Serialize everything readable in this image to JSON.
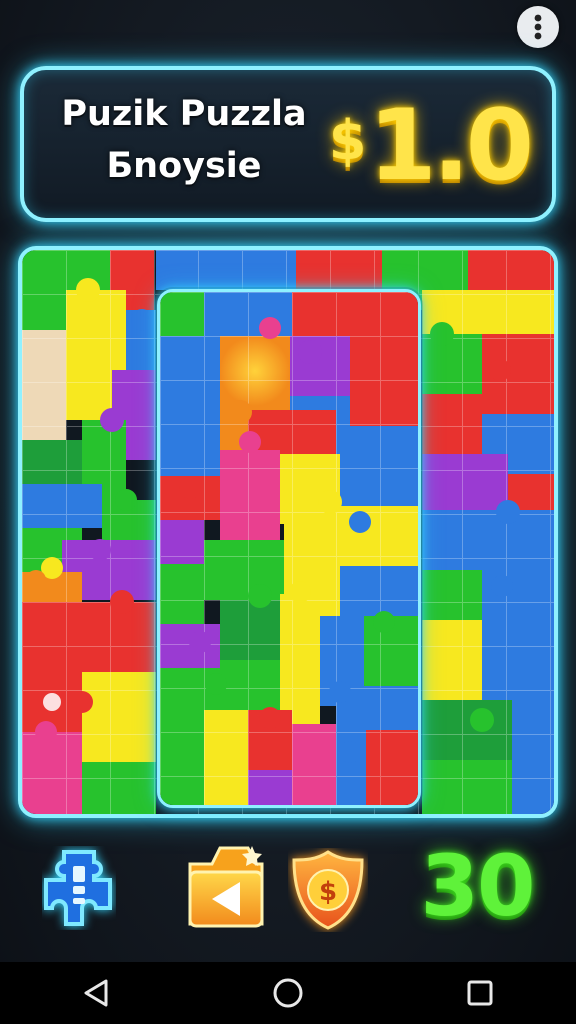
{
  "header": {
    "title_line1": "Puzik Puzzla",
    "title_line2": "Бnoysie",
    "currency_symbol": "$",
    "amount": "1.0"
  },
  "toolbar": {
    "piece_icon": "puzzle-piece-icon",
    "back_icon": "back-arrow-folder-icon",
    "coin_icon": "dollar-shield-icon",
    "score": "30"
  },
  "colors": {
    "neon_cyan": "#8ff1ff",
    "gold": "#ffe44a",
    "score_green": "#5ff23a",
    "piece_colors": [
      "#e8322f",
      "#f7e81f",
      "#27c22d",
      "#2e7be0",
      "#9a3bd2",
      "#e9408f",
      "#f28a1c",
      "#1e9e3a",
      "#eed9b7"
    ]
  },
  "system_nav": {
    "back": "back-icon",
    "home": "home-icon",
    "recents": "recents-icon"
  }
}
